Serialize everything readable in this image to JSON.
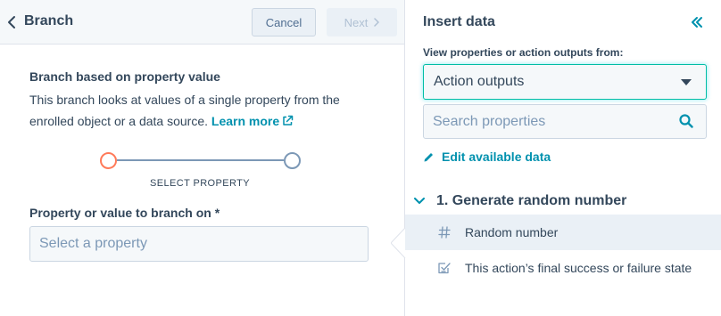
{
  "header": {
    "title": "Branch",
    "cancel_label": "Cancel",
    "next_label": "Next"
  },
  "branch": {
    "section_title": "Branch based on property value",
    "description": "This branch looks at values of a single property from the enrolled object or a data source.",
    "learn_more_label": "Learn more",
    "step_label": "SELECT PROPERTY",
    "field_label": "Property or value to branch on *",
    "select_placeholder": "Select a property"
  },
  "insert_data": {
    "title": "Insert data",
    "view_label": "View properties or action outputs from:",
    "dropdown_value": "Action outputs",
    "search_placeholder": "Search properties",
    "edit_label": "Edit available data",
    "group": {
      "title": "1. Generate random number",
      "items": [
        {
          "label": "Random number",
          "icon": "hash-icon"
        },
        {
          "label": "This action’s final success or failure state",
          "icon": "checkbox-state-icon"
        }
      ]
    }
  },
  "colors": {
    "accent_teal": "#0091ae",
    "text": "#33475b",
    "step_active": "#ff7a59",
    "step_inactive": "#7c98b6",
    "focus_border": "#00bda5"
  }
}
